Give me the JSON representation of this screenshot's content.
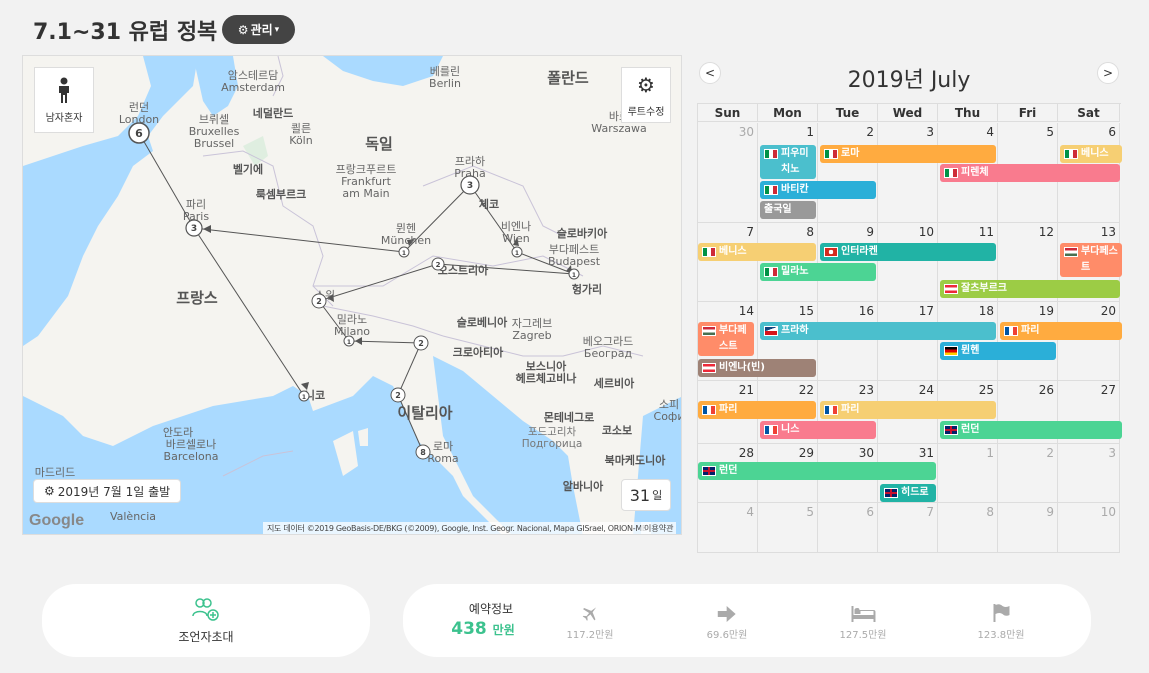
{
  "header": {
    "title": "7.1~31 유럽 정복",
    "manage_label": "관리"
  },
  "map": {
    "solo_label": "남자혼자",
    "route_edit_label": "루트수정",
    "depart_label": "2019년 7월 1일 출발",
    "days_value": "31",
    "days_unit": "일",
    "google_logo": "Google",
    "attribution": "지도 데이터 ©2019 GeoBasis-DE/BKG (©2009), Google, Inst. Geogr. Nacional, Mapa GISrael, ORION-ME",
    "terms": "이용약관",
    "labels": {
      "amsterdam_ko": "암스테르담",
      "amsterdam_en": "Amsterdam",
      "berlin_ko": "베를린",
      "berlin_en": "Berlin",
      "poland": "폴란드",
      "london_ko": "런던",
      "london_en": "London",
      "netherlands": "네덜란드",
      "brussels_ko": "브뤼셀",
      "brussels_fr": "Bruxelles",
      "brussels_nl": "Brussel",
      "cologne_ko": "쾰른",
      "cologne_en": "Köln",
      "germany": "독일",
      "belgium": "벨기에",
      "frankfurt_ko": "프랑크푸르트",
      "frankfurt_en1": "Frankfurt",
      "frankfurt_en2": "am Main",
      "luxembourg": "룩셈부르크",
      "prague_ko": "프라하",
      "prague_en": "Praha",
      "warsaw_ko": "바르",
      "warsaw_en": "Warszawa",
      "paris_ko": "파리",
      "paris_en": "Paris",
      "czech": "체코",
      "munich_ko": "뮌헨",
      "munich_en": "München",
      "vienna_ko": "비엔나",
      "vienna_en": "Wien",
      "slovakia": "슬로바키아",
      "budapest_ko": "부다페스트",
      "budapest_en": "Budapest",
      "austria": "오스트리아",
      "hungary": "헝가리",
      "france": "프랑스",
      "swiss": "스위",
      "milan_ko": "밀라노",
      "milan_en": "Milano",
      "slovenia": "슬로베니아",
      "zagreb_ko": "자그레브",
      "zagreb_en": "Zagreb",
      "belgrade_ko": "베오그라드",
      "belgrade_en": "Београд",
      "croatia": "크로아티아",
      "bosnia1": "보스니아",
      "bosnia2": "헤르체고비나",
      "serbia": "세르비아",
      "nice": "니코",
      "italy": "이탈리아",
      "andorra": "안도라",
      "barcelona_ko": "바르셀로나",
      "barcelona_en": "Barcelona",
      "montenegro": "몬테네그로",
      "podgorica_ko": "포드고리차",
      "podgorica_en": "Подгорица",
      "kosovo": "코소보",
      "sofia_ko": "소피",
      "sofia_en": "Софи",
      "rome_ko": "로마",
      "rome_en": "Roma",
      "madrid": "마드리드",
      "valencia_en": "València",
      "macedonia": "북마케도니아",
      "albania": "알바니아"
    },
    "markers": {
      "london": "6",
      "paris": "3",
      "prague": "3",
      "munich": "1",
      "vienna": "1",
      "austria": "2",
      "budapest": "1",
      "swiss": "2",
      "milan": "1",
      "venice": "2",
      "florence": "2",
      "nice": "1",
      "rome": "8"
    }
  },
  "calendar": {
    "title": "2019년 July",
    "prev": "<",
    "next": ">",
    "weekdays": [
      "Sun",
      "Mon",
      "Tue",
      "Wed",
      "Thu",
      "Fri",
      "Sat"
    ],
    "weeks": [
      [
        "30",
        "1",
        "2",
        "3",
        "4",
        "5",
        "6"
      ],
      [
        "7",
        "8",
        "9",
        "10",
        "11",
        "12",
        "13"
      ],
      [
        "14",
        "15",
        "16",
        "17",
        "18",
        "19",
        "20"
      ],
      [
        "21",
        "22",
        "23",
        "24",
        "25",
        "26",
        "27"
      ],
      [
        "28",
        "29",
        "30",
        "31",
        "1",
        "2",
        "3"
      ],
      [
        "4",
        "5",
        "6",
        "7",
        "8",
        "9",
        "10"
      ]
    ],
    "events": {
      "pisa": "피우미치노",
      "rome": "로마",
      "venice1": "베니스",
      "vatican": "바티칸",
      "florence": "피렌체",
      "departure": "출국일",
      "venice2": "베니스",
      "interlaken": "인터라켄",
      "budapest1": "부다페스트",
      "milan": "밀라노",
      "salzburg": "잘츠부르크",
      "budapest2": "부다페스트",
      "prague": "프라하",
      "paris1": "파리",
      "munich": "뮌헨",
      "vienna": "비엔나(빈)",
      "paris2": "파리",
      "paris3": "파리",
      "nice": "니스",
      "london1": "런던",
      "london2": "런던",
      "heathrow": "히드로"
    },
    "colors": {
      "teal": "#21b3a5",
      "orange": "#ffab40",
      "yellow": "#f6cf73",
      "blue": "#2bafd8",
      "pink": "#f97b8e",
      "gray": "#999999",
      "green": "#4cd494",
      "lime": "#9ccc45",
      "salmon": "#ff8c69",
      "cyan": "#4bbfcd",
      "brown": "#9e8276"
    }
  },
  "bottom": {
    "invite_label": "조언자초대",
    "booking_label": "예약정보",
    "booking_total": "438",
    "booking_unit": "만원",
    "costs": [
      {
        "icon": "plane-icon",
        "value": "117.2만원"
      },
      {
        "icon": "arrow-right-icon",
        "value": "69.6만원"
      },
      {
        "icon": "bed-icon",
        "value": "127.5만원"
      },
      {
        "icon": "flag-icon",
        "value": "123.8만원"
      }
    ]
  }
}
